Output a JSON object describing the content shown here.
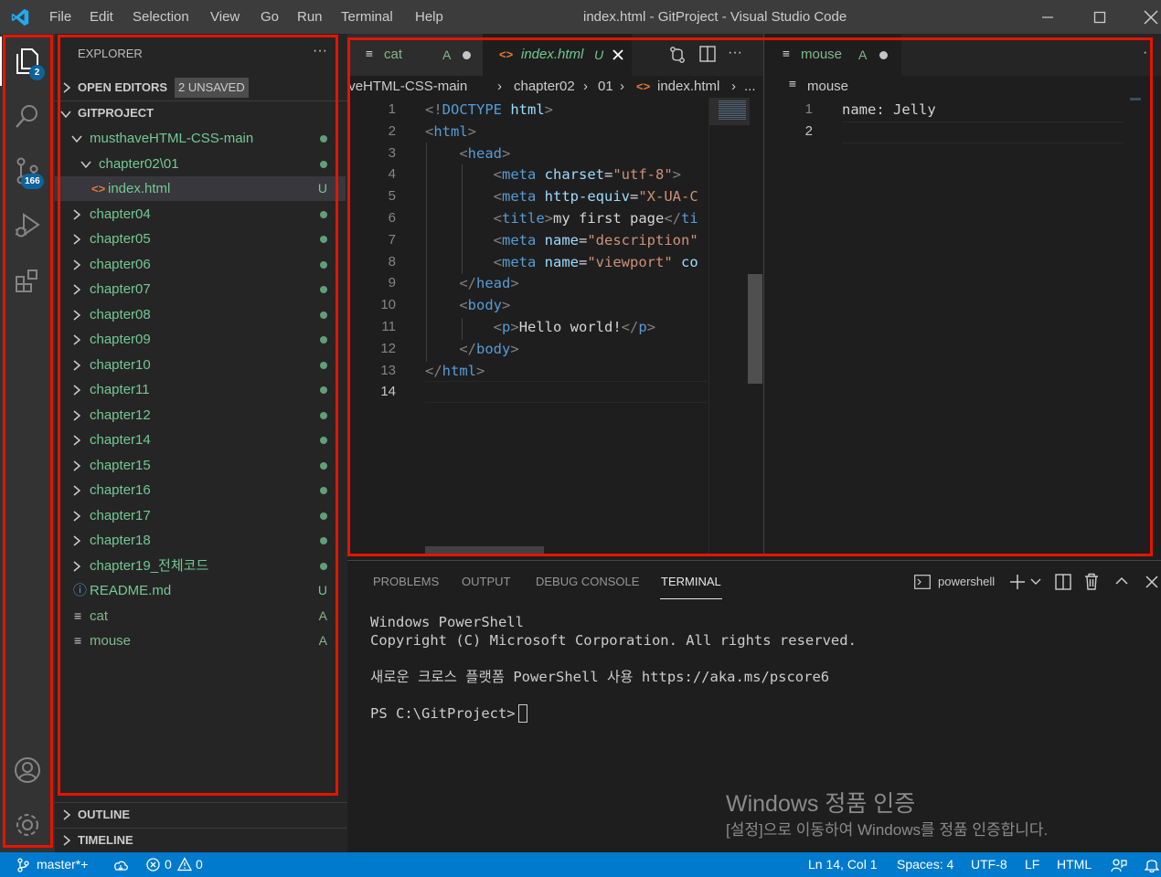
{
  "menu": [
    "File",
    "Edit",
    "Selection",
    "View",
    "Go",
    "Run",
    "Terminal",
    "Help"
  ],
  "window_title": "index.html - GitProject - Visual Studio Code",
  "activity": {
    "explorer_badge": "2",
    "scm_badge": "166"
  },
  "sidebar": {
    "title": "EXPLORER",
    "more": "···",
    "open_editors": {
      "label": "OPEN EDITORS",
      "badge": "2 UNSAVED"
    },
    "project": "GITPROJECT",
    "tree": [
      {
        "label": "musthaveHTML-CSS-main",
        "kind": "folder-open",
        "status": "dot",
        "color": "#73c991"
      },
      {
        "label": "chapter02\\01",
        "kind": "folder-open",
        "status": "dot",
        "color": "#73c991"
      },
      {
        "label": "index.html",
        "kind": "html-file",
        "status": "U",
        "color": "#73c991"
      },
      {
        "label": "chapter04",
        "kind": "folder",
        "status": "dot",
        "color": "#73c991"
      },
      {
        "label": "chapter05",
        "kind": "folder",
        "status": "dot",
        "color": "#73c991"
      },
      {
        "label": "chapter06",
        "kind": "folder",
        "status": "dot",
        "color": "#73c991"
      },
      {
        "label": "chapter07",
        "kind": "folder",
        "status": "dot",
        "color": "#73c991"
      },
      {
        "label": "chapter08",
        "kind": "folder",
        "status": "dot",
        "color": "#73c991"
      },
      {
        "label": "chapter09",
        "kind": "folder",
        "status": "dot",
        "color": "#73c991"
      },
      {
        "label": "chapter10",
        "kind": "folder",
        "status": "dot",
        "color": "#73c991"
      },
      {
        "label": "chapter11",
        "kind": "folder",
        "status": "dot",
        "color": "#73c991"
      },
      {
        "label": "chapter12",
        "kind": "folder",
        "status": "dot",
        "color": "#73c991"
      },
      {
        "label": "chapter14",
        "kind": "folder",
        "status": "dot",
        "color": "#73c991"
      },
      {
        "label": "chapter15",
        "kind": "folder",
        "status": "dot",
        "color": "#73c991"
      },
      {
        "label": "chapter16",
        "kind": "folder",
        "status": "dot",
        "color": "#73c991"
      },
      {
        "label": "chapter17",
        "kind": "folder",
        "status": "dot",
        "color": "#73c991"
      },
      {
        "label": "chapter18",
        "kind": "folder",
        "status": "dot",
        "color": "#73c991"
      },
      {
        "label": "chapter19_전체코드",
        "kind": "folder",
        "status": "dot",
        "color": "#73c991"
      },
      {
        "label": "README.md",
        "kind": "info-file",
        "status": "U",
        "color": "#73c991"
      },
      {
        "label": "cat",
        "kind": "text-file",
        "status": "A",
        "color": "#81b88b"
      },
      {
        "label": "mouse",
        "kind": "text-file",
        "status": "A",
        "color": "#81b88b"
      }
    ],
    "outline": "OUTLINE",
    "timeline": "TIMELINE"
  },
  "editor1": {
    "tabs": [
      {
        "label": "cat",
        "status": "A"
      },
      {
        "label": "index.html",
        "status": "U"
      }
    ],
    "breadcrumb": [
      "musthaveHTML-CSS-main",
      "chapter02",
      "01",
      "index.html",
      "..."
    ],
    "line_numbers": [
      "1",
      "2",
      "3",
      "4",
      "5",
      "6",
      "7",
      "8",
      "9",
      "10",
      "11",
      "12",
      "13",
      "14"
    ],
    "current_line": "14",
    "code_lines": [
      [
        [
          "brk",
          "<!"
        ],
        [
          "tag",
          "DOCTYPE"
        ],
        [
          "txt",
          " "
        ],
        [
          "attr",
          "html"
        ],
        [
          "brk",
          ">"
        ]
      ],
      [
        [
          "brk",
          "<"
        ],
        [
          "tag",
          "html"
        ],
        [
          "brk",
          ">"
        ]
      ],
      [
        [
          "txt",
          "    "
        ],
        [
          "brk",
          "<"
        ],
        [
          "tag",
          "head"
        ],
        [
          "brk",
          ">"
        ]
      ],
      [
        [
          "txt",
          "        "
        ],
        [
          "brk",
          "<"
        ],
        [
          "tag",
          "meta"
        ],
        [
          "txt",
          " "
        ],
        [
          "attr",
          "charset"
        ],
        [
          "txt",
          "="
        ],
        [
          "str",
          "\"utf-8\""
        ],
        [
          "brk",
          ">"
        ]
      ],
      [
        [
          "txt",
          "        "
        ],
        [
          "brk",
          "<"
        ],
        [
          "tag",
          "meta"
        ],
        [
          "txt",
          " "
        ],
        [
          "attr",
          "http-equiv"
        ],
        [
          "txt",
          "="
        ],
        [
          "str",
          "\"X-UA-C"
        ]
      ],
      [
        [
          "txt",
          "        "
        ],
        [
          "brk",
          "<"
        ],
        [
          "tag",
          "title"
        ],
        [
          "brk",
          ">"
        ],
        [
          "txt",
          "my first page"
        ],
        [
          "brk",
          "</"
        ],
        [
          "tag",
          "ti"
        ]
      ],
      [
        [
          "txt",
          "        "
        ],
        [
          "brk",
          "<"
        ],
        [
          "tag",
          "meta"
        ],
        [
          "txt",
          " "
        ],
        [
          "attr",
          "name"
        ],
        [
          "txt",
          "="
        ],
        [
          "str",
          "\"description\""
        ]
      ],
      [
        [
          "txt",
          "        "
        ],
        [
          "brk",
          "<"
        ],
        [
          "tag",
          "meta"
        ],
        [
          "txt",
          " "
        ],
        [
          "attr",
          "name"
        ],
        [
          "txt",
          "="
        ],
        [
          "str",
          "\"viewport\""
        ],
        [
          "txt",
          " "
        ],
        [
          "attr",
          "co"
        ]
      ],
      [
        [
          "txt",
          "    "
        ],
        [
          "brk",
          "</"
        ],
        [
          "tag",
          "head"
        ],
        [
          "brk",
          ">"
        ]
      ],
      [
        [
          "txt",
          "    "
        ],
        [
          "brk",
          "<"
        ],
        [
          "tag",
          "body"
        ],
        [
          "brk",
          ">"
        ]
      ],
      [
        [
          "txt",
          "        "
        ],
        [
          "brk",
          "<"
        ],
        [
          "tag",
          "p"
        ],
        [
          "brk",
          ">"
        ],
        [
          "txt",
          "Hello world!"
        ],
        [
          "brk",
          "</"
        ],
        [
          "tag",
          "p"
        ],
        [
          "brk",
          ">"
        ]
      ],
      [
        [
          "txt",
          "    "
        ],
        [
          "brk",
          "</"
        ],
        [
          "tag",
          "body"
        ],
        [
          "brk",
          ">"
        ]
      ],
      [
        [
          "brk",
          "</"
        ],
        [
          "tag",
          "html"
        ],
        [
          "brk",
          ">"
        ]
      ],
      [
        [
          "txt",
          ""
        ]
      ]
    ]
  },
  "editor2": {
    "tab": {
      "label": "mouse",
      "status": "A"
    },
    "breadcrumb": "mouse",
    "line_numbers": [
      "1",
      "2"
    ],
    "lines": [
      "name: Jelly",
      ""
    ]
  },
  "panel": {
    "tabs": [
      "PROBLEMS",
      "OUTPUT",
      "DEBUG CONSOLE",
      "TERMINAL"
    ],
    "active_tab": "TERMINAL",
    "shell": "powershell",
    "terminal_lines": [
      "Windows PowerShell",
      "Copyright (C) Microsoft Corporation. All rights reserved.",
      "",
      "새로운 크로스 플랫폼 PowerShell 사용 https://aka.ms/pscore6",
      "",
      "PS C:\\GitProject> "
    ]
  },
  "watermark": {
    "line1": "Windows 정품 인증",
    "line2": "[설정]으로 이동하여 Windows를 정품 인증합니다."
  },
  "status": {
    "branch": "master*+",
    "errors": "0",
    "warnings": "0",
    "position": "Ln 14, Col 1",
    "spaces": "Spaces: 4",
    "encoding": "UTF-8",
    "eol": "LF",
    "language": "HTML"
  },
  "colors": {
    "accent": "#007acc",
    "git_untracked": "#73c991",
    "git_added": "#81b88b",
    "highlight_box": "#e51400"
  }
}
